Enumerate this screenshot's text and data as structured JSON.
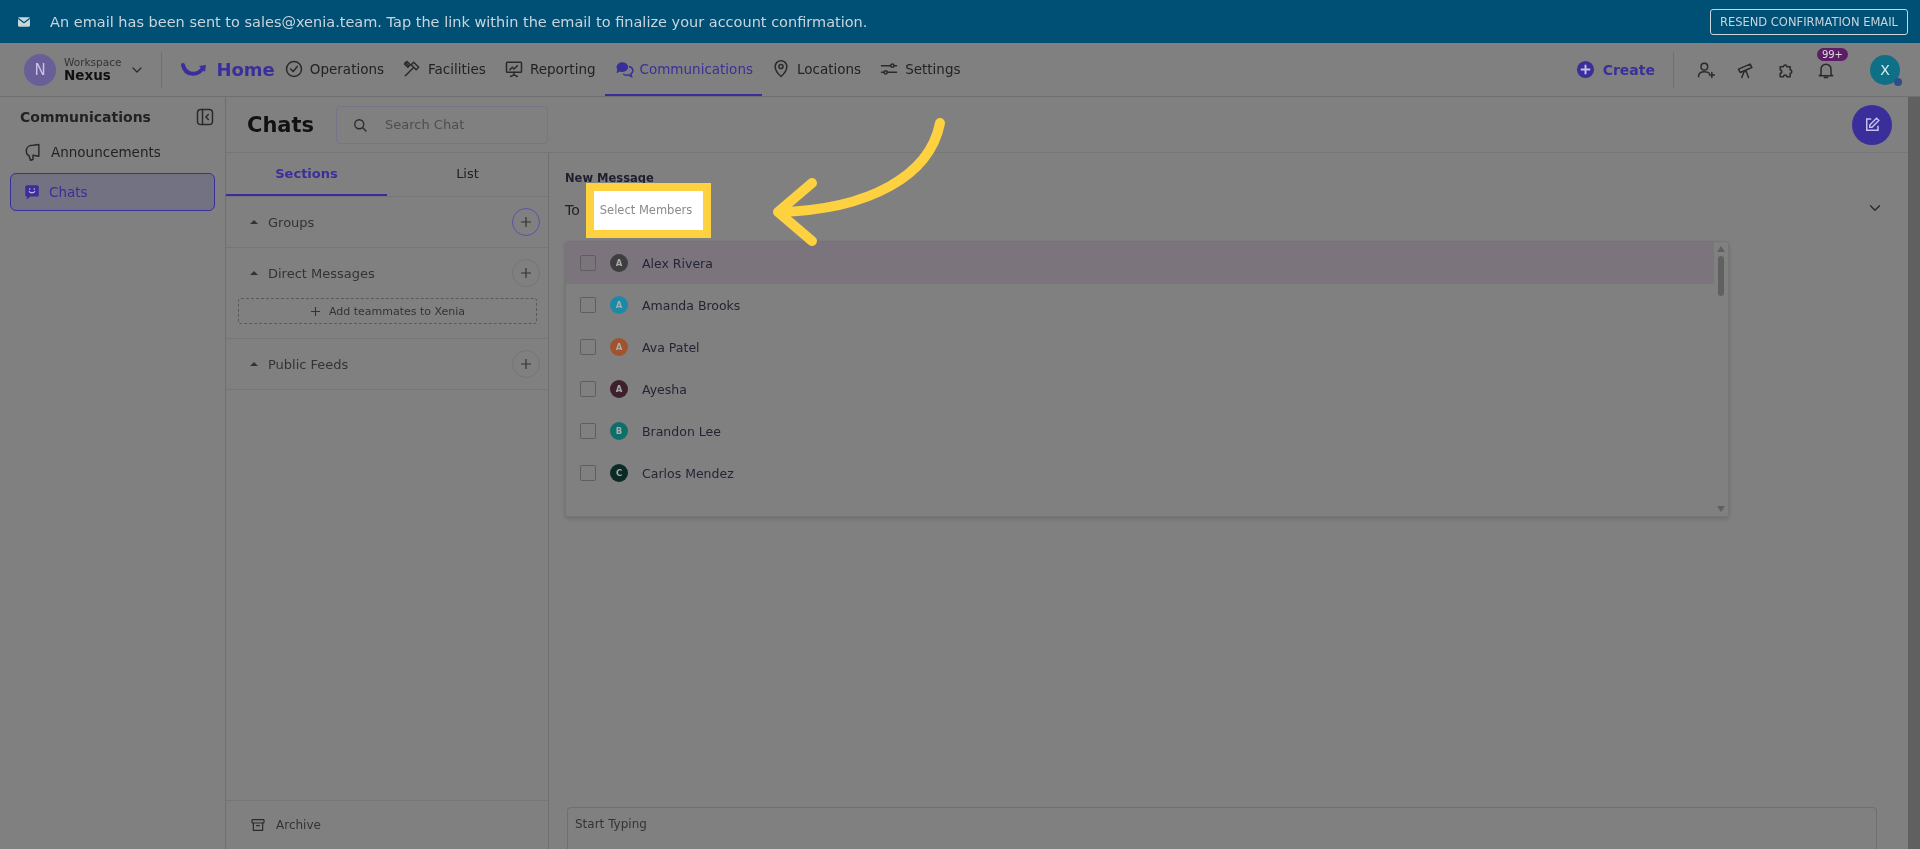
{
  "banner": {
    "message": "An email has been sent to sales@xenia.team. Tap the link within the email to finalize your account confirmation.",
    "button": "RESEND CONFIRMATION EMAIL"
  },
  "workspace": {
    "initial": "N",
    "label": "Workspace",
    "name": "Nexus"
  },
  "home": "Home",
  "nav": [
    {
      "label": "Operations",
      "selected": false
    },
    {
      "label": "Facilities",
      "selected": false
    },
    {
      "label": "Reporting",
      "selected": false
    },
    {
      "label": "Communications",
      "selected": true
    },
    {
      "label": "Locations",
      "selected": false
    },
    {
      "label": "Settings",
      "selected": false
    }
  ],
  "create": "Create",
  "notifications_badge": "99+",
  "avatar": "X",
  "sidebar": {
    "title": "Communications",
    "items": [
      {
        "label": "Announcements",
        "selected": false
      },
      {
        "label": "Chats",
        "selected": true
      }
    ]
  },
  "chats": {
    "title": "Chats",
    "search_placeholder": "Search Chat",
    "tabs": [
      {
        "label": "Sections",
        "selected": true
      },
      {
        "label": "List",
        "selected": false
      }
    ],
    "sections": [
      {
        "title": "Groups"
      },
      {
        "title": "Direct Messages",
        "action": "Add teammates to Xenia"
      },
      {
        "title": "Public Feeds"
      }
    ],
    "archive": "Archive"
  },
  "message": {
    "label": "New Message",
    "to": "To",
    "placeholder": "Select Members",
    "members": [
      {
        "name": "Alex Rivera",
        "initial": "A",
        "color": "#3e3e40",
        "checked": false,
        "selected": true
      },
      {
        "name": "Amanda Brooks",
        "initial": "A",
        "color": "#1a8aa6",
        "checked": false,
        "selected": false
      },
      {
        "name": "Ava Patel",
        "initial": "A",
        "color": "#a0542c",
        "checked": false,
        "selected": false
      },
      {
        "name": "Ayesha",
        "initial": "A",
        "color": "#3e1f2c",
        "checked": false,
        "selected": false
      },
      {
        "name": "Brandon Lee",
        "initial": "B",
        "color": "#0c6f6a",
        "checked": false,
        "selected": false
      },
      {
        "name": "Carlos Mendez",
        "initial": "C",
        "color": "#0b2a26",
        "checked": false,
        "selected": false
      }
    ],
    "composer_placeholder": "Start Typing"
  }
}
